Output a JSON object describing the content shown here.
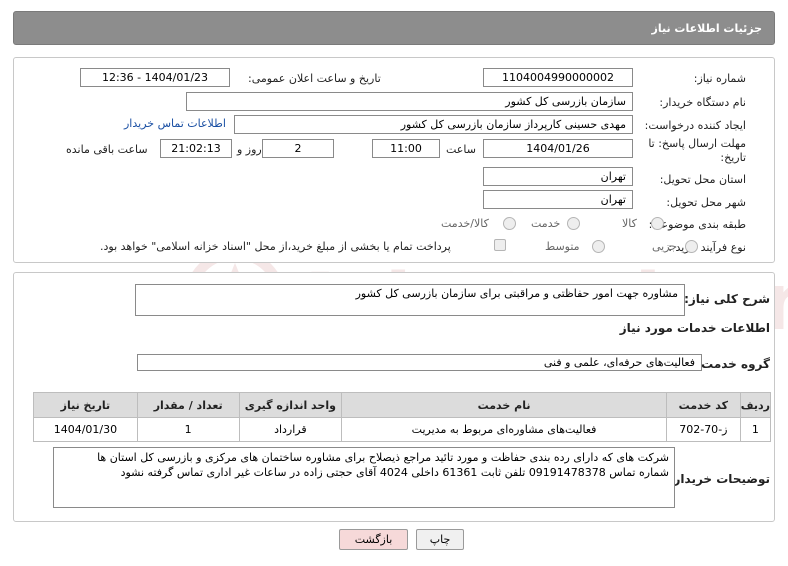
{
  "header": {
    "title": "جزئیات اطلاعات نیاز"
  },
  "form": {
    "need_number_label": "شماره نیاز:",
    "need_number": "1104004990000002",
    "announce_label": "تاریخ و ساعت اعلان عمومی:",
    "announce_value": "1404/01/23 - 12:36",
    "buyer_org_label": "نام دستگاه خریدار:",
    "buyer_org": "سازمان بازرسی کل کشور",
    "requester_label": "ایجاد کننده درخواست:",
    "requester": "مهدی حسینی کارپرداز سازمان بازرسی کل کشور",
    "contact_link": "اطلاعات تماس خریدار",
    "deadline_label_1": "مهلت ارسال پاسخ: تا",
    "deadline_label_2": "تاریخ:",
    "deadline_date": "1404/01/26",
    "time_label": "ساعت",
    "deadline_time": "11:00",
    "days_value": "2",
    "days_label": "روز و",
    "remaining_time": "21:02:13",
    "remaining_label": "ساعت باقی مانده",
    "province_label": "استان محل تحویل:",
    "province": "تهران",
    "city_label": "شهر محل تحویل:",
    "city": "تهران",
    "category_label": "طبقه بندی موضوعی:",
    "category_options": [
      "کالا",
      "خدمت",
      "کالا/خدمت"
    ],
    "process_label": "نوع فرآیند خرید :",
    "process_options": [
      "جزیی",
      "متوسط"
    ],
    "payment_text": "پرداخت تمام یا بخشی از مبلغ خرید،از محل \"اسناد خزانه اسلامی\" خواهد بود."
  },
  "details": {
    "summary_label": "شرح کلی نیاز:",
    "summary": "مشاوره جهت امور حفاظتی و مراقبتی برای سازمان بازرسی کل کشور",
    "services_title": "اطلاعات خدمات مورد نیاز",
    "service_group_label": "گروه خدمت:",
    "service_group": "فعالیت‌های حرفه‌ای، علمی و فنی",
    "table": {
      "headers": [
        "ردیف",
        "کد خدمت",
        "نام خدمت",
        "واحد اندازه گیری",
        "تعداد / مقدار",
        "تاریخ نیاز"
      ],
      "rows": [
        [
          "1",
          "ز-70-702",
          "فعالیت‌های مشاوره‌ای مربوط به مدیریت",
          "قرارداد",
          "1",
          "1404/01/30"
        ]
      ]
    },
    "buyer_notes_label": "توضیحات خریدار:",
    "buyer_notes_line1": "شرکت های که دارای رده بندی حفاظت و مورد تائید مراجع ذیصلاح برای مشاوره ساختمان های مرکزی و بازرسی کل استان ها",
    "buyer_notes_line2": "شماره تماس 09191478378   تلفن ثابت 61361  داخلی 4024  آقای حجتی زاده  در ساعات غیر اداری تماس گرفته نشود"
  },
  "buttons": {
    "print": "چاپ",
    "back": "بازگشت"
  },
  "watermark": {
    "text": "AriaTender.net"
  },
  "colors": {
    "header_bg": "#8d8d8d",
    "link": "#1a4fa3",
    "back_button_bg": "#f6d9d9"
  }
}
